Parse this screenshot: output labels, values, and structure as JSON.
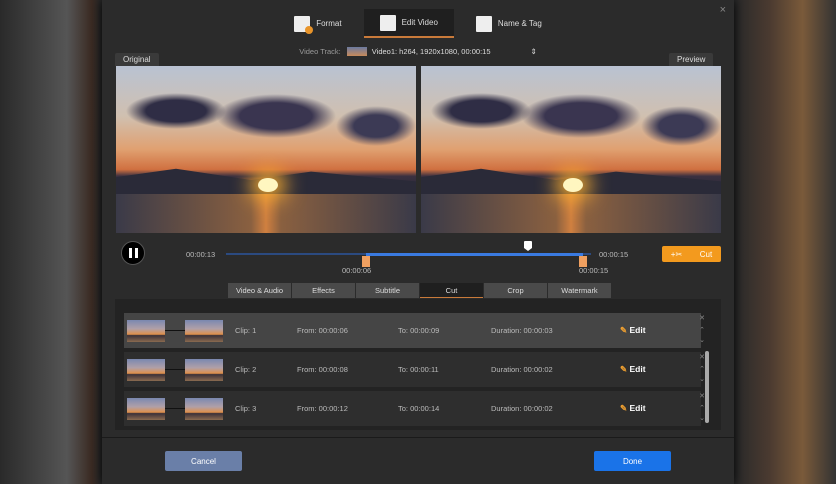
{
  "tabs": [
    {
      "label": "Format"
    },
    {
      "label": "Edit Video"
    },
    {
      "label": "Name & Tag"
    }
  ],
  "close_icon": "×",
  "video_track": {
    "label": "Video Track:",
    "value": "Video1: h264, 1920x1080, 00:00:15"
  },
  "original_label": "Original",
  "preview_label": "Preview",
  "timeline": {
    "current": "00:00:13",
    "end": "00:00:15",
    "start_marker": "00:00:06",
    "end_marker": "00:00:15",
    "progress_fraction": 0.82
  },
  "cut_button": "Cut",
  "subtabs": [
    "Video & Audio",
    "Effects",
    "Subtitle",
    "Cut",
    "Crop",
    "Watermark"
  ],
  "clips": [
    {
      "clip": "Clip: 1",
      "from": "From:  00:00:06",
      "to": "To:  00:00:09",
      "duration": "Duration:  00:00:03",
      "edit": "Edit"
    },
    {
      "clip": "Clip: 2",
      "from": "From:  00:00:08",
      "to": "To:  00:00:11",
      "duration": "Duration:  00:00:02",
      "edit": "Edit"
    },
    {
      "clip": "Clip: 3",
      "from": "From:  00:00:12",
      "to": "To:  00:00:14",
      "duration": "Duration:  00:00:02",
      "edit": "Edit"
    }
  ],
  "cancel": "Cancel",
  "done": "Done",
  "colors": {
    "accent": "#f39a1e",
    "done": "#1a73e8",
    "cancel": "#6a7fa8",
    "timeline": "#3a7ae0"
  }
}
